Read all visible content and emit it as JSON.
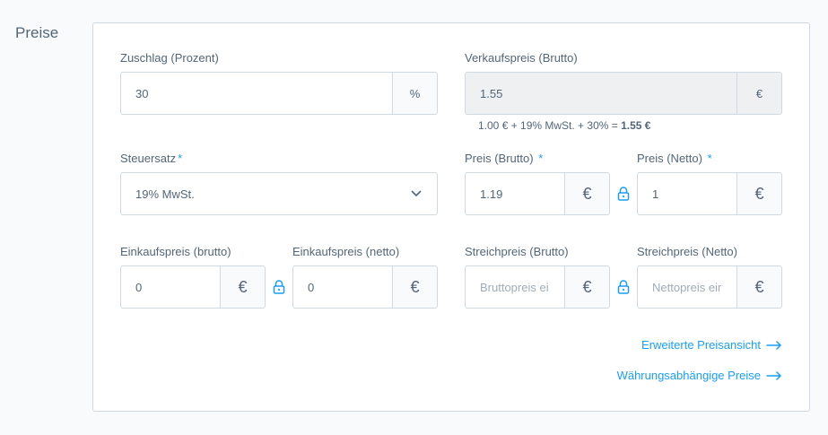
{
  "section": {
    "title": "Preise"
  },
  "markup": {
    "label": "Zuschlag (Prozent)",
    "value": "30",
    "unit": "%"
  },
  "selling_price": {
    "label": "Verkaufspreis (Brutto)",
    "value": "1.55",
    "unit": "€",
    "calc_text": "1.00 € + 19% MwSt. + 30% =",
    "calc_result": "1.55 €"
  },
  "tax": {
    "label": "Steuersatz",
    "required_mark": "*",
    "value": "19% MwSt."
  },
  "price_gross": {
    "label": "Preis (Brutto)",
    "required_mark": "*",
    "value": "1.19",
    "unit": "€"
  },
  "price_net": {
    "label": "Preis (Netto)",
    "required_mark": "*",
    "value": "1",
    "unit": "€"
  },
  "purchase_gross": {
    "label": "Einkaufspreis (brutto)",
    "value": "0",
    "unit": "€"
  },
  "purchase_net": {
    "label": "Einkaufspreis (netto)",
    "value": "0",
    "unit": "€"
  },
  "list_gross": {
    "label": "Streichpreis (Brutto)",
    "placeholder": "Bruttopreis ei",
    "unit": "€"
  },
  "list_net": {
    "label": "Streichpreis (Netto)",
    "placeholder": "Nettopreis eir",
    "unit": "€"
  },
  "links": {
    "advanced": "Erweiterte Preisansicht",
    "currency": "Währungsabhängige Preise"
  },
  "colors": {
    "accent": "#189eff",
    "text": "#52667a",
    "border": "#d1d9e0"
  }
}
